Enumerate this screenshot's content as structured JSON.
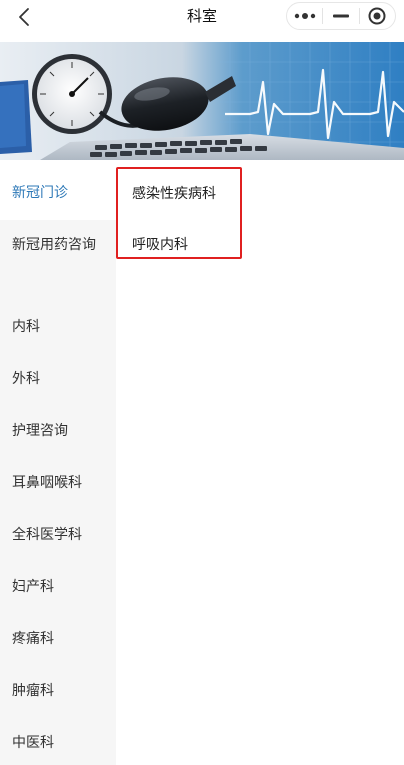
{
  "nav": {
    "title": "科室",
    "back_icon": "chevron-left-icon",
    "more_icon": "more-dots-icon",
    "minimize_icon": "minus-icon",
    "close_icon": "target-circle-icon"
  },
  "banner": {
    "description_icon": "blood-pressure-monitor-icon"
  },
  "sidebar": {
    "items": [
      {
        "label": "新冠门诊",
        "active": true
      },
      {
        "label": "新冠用药咨询"
      },
      {
        "label": "内科"
      },
      {
        "label": "外科"
      },
      {
        "label": "护理咨询"
      },
      {
        "label": "耳鼻咽喉科"
      },
      {
        "label": "全科医学科"
      },
      {
        "label": "妇产科"
      },
      {
        "label": "疼痛科"
      },
      {
        "label": "肿瘤科"
      },
      {
        "label": "中医科"
      }
    ]
  },
  "departments": {
    "items": [
      {
        "label": "感染性疾病科"
      },
      {
        "label": "呼吸内科"
      }
    ]
  },
  "colors": {
    "accent": "#2d78b7",
    "highlight": "#e02020",
    "sidebar_bg": "#f6f6f6"
  }
}
